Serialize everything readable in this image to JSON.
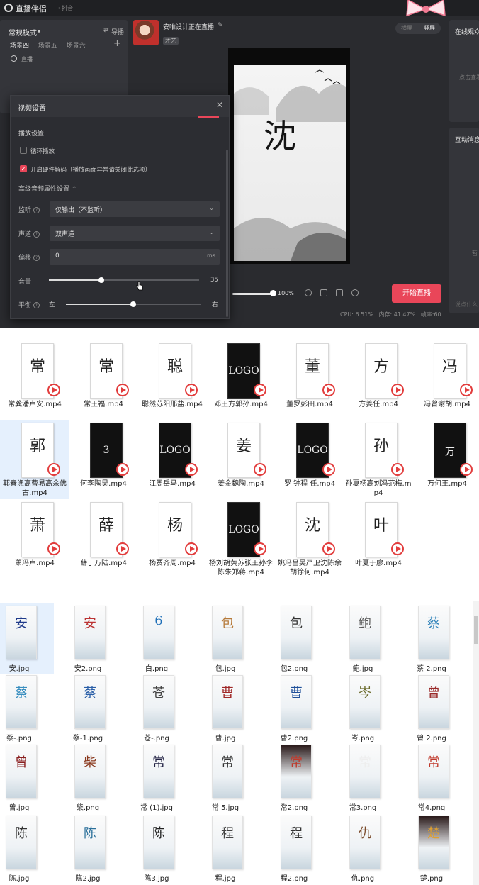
{
  "app": {
    "name": "直播伴侣",
    "subtitle": "· 抖音",
    "mode": "常规模式",
    "import_label": "导播",
    "scenes": [
      "场景四",
      "场景五",
      "场景六"
    ],
    "live_label": "直播",
    "stream_title": "安唯设计正在直播",
    "stream_category": "才艺",
    "orientation": [
      "横屏",
      "竖屏"
    ],
    "right_panel_title": "在线观众",
    "right_panel_hint": "点击查看",
    "interact_title": "互动消息",
    "interact_hint": "暂",
    "interact_input": "说点什么",
    "preview_glyph": "沈",
    "volume_pct": "100%",
    "start_label": "开始直播",
    "status": {
      "cpu": "CPU: 6.51%",
      "mem": "内存: 41.47%",
      "fps": "帧率:60"
    },
    "colors": {
      "accent": "#e94659",
      "bg": "#2a2b2f"
    }
  },
  "dialog": {
    "title": "视频设置",
    "section_playback": "播放设置",
    "loop_label": "循环播放",
    "hw_decode_label": "开启硬件解码（播放画面异常请关闭此选项）",
    "advanced_label": "高级音频属性设置",
    "monitor_label": "监听",
    "monitor_value": "仅输出（不监听）",
    "channel_label": "声道",
    "channel_value": "双声道",
    "offset_label": "偏移",
    "offset_value": "0",
    "offset_unit": "ms",
    "volume_label": "音量",
    "volume_value": "35",
    "volume_fraction": 0.35,
    "balance_label": "平衡",
    "balance_left": "左",
    "balance_right": "右",
    "balance_fraction": 0.5
  },
  "videos": [
    {
      "name": "常龚潘卢安.mp4",
      "glyph": "常",
      "dark": false
    },
    {
      "name": "常王福.mp4",
      "glyph": "常",
      "dark": false
    },
    {
      "name": "聪然苏阳邢盐.mp4",
      "glyph": "聪",
      "dark": false
    },
    {
      "name": "邓王方郭孙.mp4",
      "glyph": "LOGO",
      "dark": true
    },
    {
      "name": "董罗彭田.mp4",
      "glyph": "董",
      "dark": false
    },
    {
      "name": "方姜任.mp4",
      "glyph": "方",
      "dark": false
    },
    {
      "name": "冯曾谢胡.mp4",
      "glyph": "冯",
      "dark": false
    },
    {
      "name": "郭春漁高曹易高余佛古.mp4",
      "glyph": "郭",
      "dark": false
    },
    {
      "name": "何李陶吴.mp4",
      "glyph": "3",
      "dark": true
    },
    {
      "name": "江周岳马.mp4",
      "glyph": "LOGO",
      "dark": true
    },
    {
      "name": "姜金魏陶.mp4",
      "glyph": "姜",
      "dark": false
    },
    {
      "name": "罗 钟程 任.mp4",
      "glyph": "LOGO",
      "dark": true
    },
    {
      "name": "孙夏杨高刘冯范梅.mp4",
      "glyph": "孙",
      "dark": false
    },
    {
      "name": "万何王.mp4",
      "glyph": "万",
      "dark": true
    },
    {
      "name": "萧冯卢.mp4",
      "glyph": "萧",
      "dark": false
    },
    {
      "name": "薛丁万陆.mp4",
      "glyph": "薛",
      "dark": false
    },
    {
      "name": "杨贾齐周.mp4",
      "glyph": "杨",
      "dark": false
    },
    {
      "name": "杨刘胡黄苏张王孙李陈朱郑蒋.mp4",
      "glyph": "LOGO",
      "dark": true
    },
    {
      "name": "姚冯吕吴严卫沈陈余胡徐何.mp4",
      "glyph": "沈",
      "dark": false
    },
    {
      "name": "叶夏于廖.mp4",
      "glyph": "叶",
      "dark": false
    }
  ],
  "images": [
    {
      "name": "安.jpg",
      "glyph": "安",
      "color": "#1f3a8a"
    },
    {
      "name": "安2.png",
      "glyph": "安",
      "color": "#b33"
    },
    {
      "name": "白.png",
      "glyph": "6",
      "color": "#1e6fb8"
    },
    {
      "name": "包.jpg",
      "glyph": "包",
      "color": "#b67a3a"
    },
    {
      "name": "包2.png",
      "glyph": "包",
      "color": "#333"
    },
    {
      "name": "鲍.jpg",
      "glyph": "鲍",
      "color": "#555"
    },
    {
      "name": "蔡 2.png",
      "glyph": "蔡",
      "color": "#2a7fb8"
    },
    {
      "name": "蔡-.png",
      "glyph": "蔡",
      "color": "#3a8fc0"
    },
    {
      "name": "蔡-1.png",
      "glyph": "蔡",
      "color": "#2a5fa8"
    },
    {
      "name": "苍-.png",
      "glyph": "苍",
      "color": "#444"
    },
    {
      "name": "曹.jpg",
      "glyph": "曹",
      "color": "#a02828"
    },
    {
      "name": "曹2.png",
      "glyph": "曹",
      "color": "#1e4f9a"
    },
    {
      "name": "岑.png",
      "glyph": "岑",
      "color": "#6a6a2a"
    },
    {
      "name": "曾 2.png",
      "glyph": "曾",
      "color": "#9a2a2a"
    },
    {
      "name": "曾.jpg",
      "glyph": "曾",
      "color": "#8a1f1f"
    },
    {
      "name": "柴.png",
      "glyph": "柴",
      "color": "#8a3a1f"
    },
    {
      "name": "常 (1).jpg",
      "glyph": "常",
      "color": "#224"
    },
    {
      "name": "常 5.jpg",
      "glyph": "常",
      "color": "#333"
    },
    {
      "name": "常2.png",
      "glyph": "常",
      "color": "#c0392b"
    },
    {
      "name": "常3.png",
      "glyph": "常",
      "color": "#eee"
    },
    {
      "name": "常4.png",
      "glyph": "常",
      "color": "#c0392b"
    },
    {
      "name": "陈.jpg",
      "glyph": "陈",
      "color": "#333"
    },
    {
      "name": "陈2.jpg",
      "glyph": "陈",
      "color": "#2a6f9a"
    },
    {
      "name": "陈3.jpg",
      "glyph": "陈",
      "color": "#222"
    },
    {
      "name": "程.jpg",
      "glyph": "程",
      "color": "#444"
    },
    {
      "name": "程2.png",
      "glyph": "程",
      "color": "#333"
    },
    {
      "name": "仇.png",
      "glyph": "仇",
      "color": "#7a4a2a"
    },
    {
      "name": "楚.png",
      "glyph": "楚",
      "color": "#e0a030"
    }
  ]
}
